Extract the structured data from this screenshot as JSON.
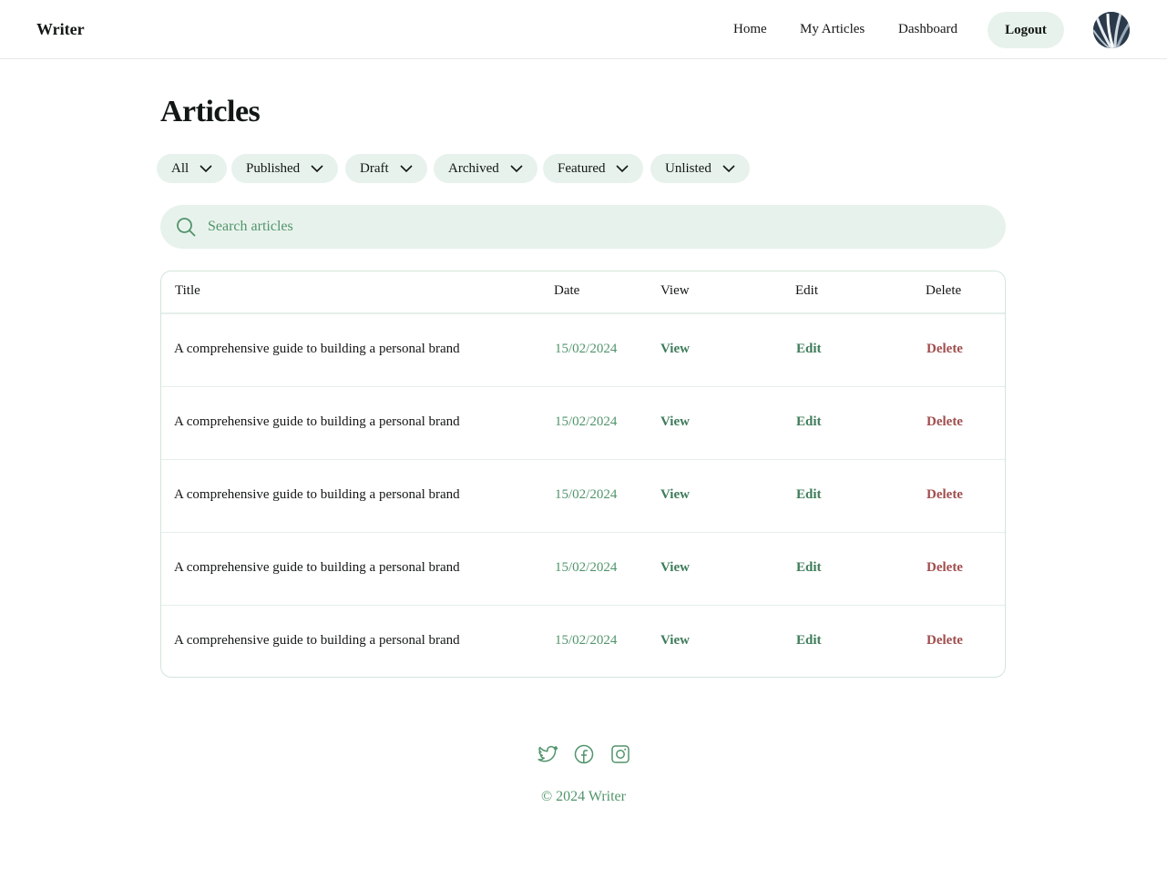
{
  "header": {
    "brand": "Writer",
    "nav": [
      "Home",
      "My Articles",
      "Dashboard"
    ],
    "logout_label": "Logout"
  },
  "page": {
    "title": "Articles"
  },
  "filters": [
    "All",
    "Published",
    "Draft",
    "Archived",
    "Featured",
    "Unlisted"
  ],
  "search": {
    "placeholder": "Search articles"
  },
  "table": {
    "columns": [
      "Title",
      "Date",
      "View",
      "Edit",
      "Delete"
    ],
    "rows": [
      {
        "title": "A comprehensive guide to building a personal brand",
        "date": "15/02/2024",
        "view": "View",
        "edit": "Edit",
        "delete": "Delete"
      },
      {
        "title": "A comprehensive guide to building a personal brand",
        "date": "15/02/2024",
        "view": "View",
        "edit": "Edit",
        "delete": "Delete"
      },
      {
        "title": "A comprehensive guide to building a personal brand",
        "date": "15/02/2024",
        "view": "View",
        "edit": "Edit",
        "delete": "Delete"
      },
      {
        "title": "A comprehensive guide to building a personal brand",
        "date": "15/02/2024",
        "view": "View",
        "edit": "Edit",
        "delete": "Delete"
      },
      {
        "title": "A comprehensive guide to building a personal brand",
        "date": "15/02/2024",
        "view": "View",
        "edit": "Edit",
        "delete": "Delete"
      }
    ]
  },
  "footer": {
    "icons": [
      "twitter-icon",
      "facebook-icon",
      "instagram-icon"
    ],
    "copyright": "© 2024 Writer"
  },
  "colors": {
    "accent_bg": "#e8f2ec",
    "accent_text": "#51946b",
    "link_green": "#3e7c5a",
    "delete_red": "#a14e4e"
  }
}
